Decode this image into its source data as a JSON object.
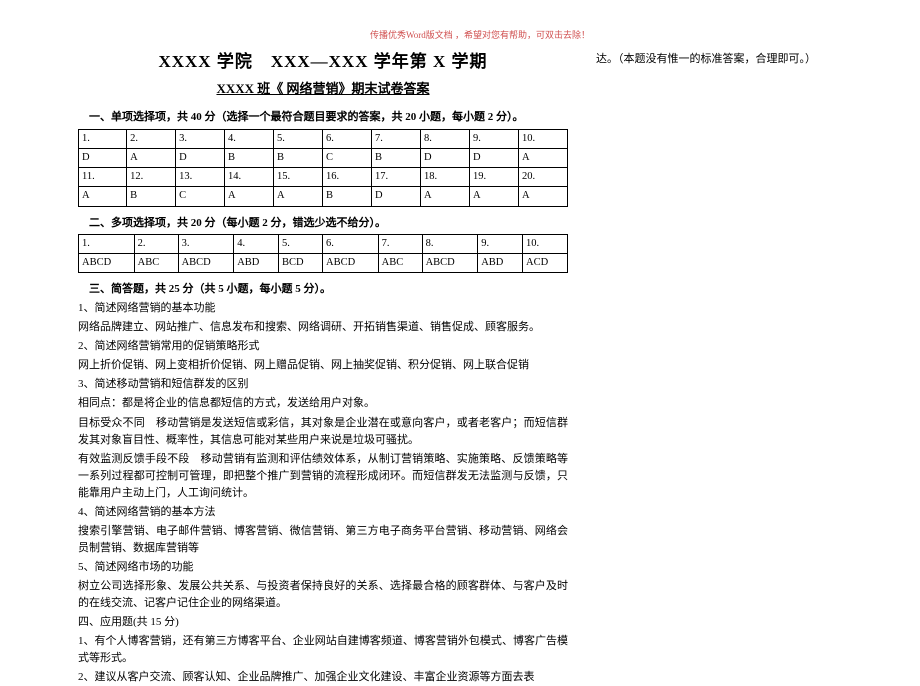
{
  "header_note": "传播优秀Word版文档 ，希望对您有帮助，可双击去除！",
  "title": "XXXX 学院　XXX—XXX 学年第 X 学期",
  "subtitle": "XXXX 班《 网络营销》期末试卷答案",
  "right_note": "达。（本题没有惟一的标准答案，合理即可。）",
  "section1_head": "一、单项选择项，共 40 分（选择一个最符合题目要求的答案，共 20 小题，每小题 2 分）。",
  "section2_head": "二、多项选择项，共 20 分（每小题 2 分，错选少选不给分）。",
  "section3_head": "三、简答题，共 25 分（共 5 小题，每小题 5 分）。",
  "section4_head": "四、应用题(共 15 分)",
  "table1": {
    "r1": [
      "1.",
      "2.",
      "3.",
      "4.",
      "5.",
      "6.",
      "7.",
      "8.",
      "9.",
      "10."
    ],
    "r2": [
      "D",
      "A",
      "D",
      "B",
      "B",
      "C",
      "B",
      "D",
      "D",
      "A"
    ],
    "r3": [
      "11.",
      "12.",
      "13.",
      "14.",
      "15.",
      "16.",
      "17.",
      "18.",
      "19.",
      "20."
    ],
    "r4": [
      "A",
      "B",
      "C",
      "A",
      "A",
      "B",
      "D",
      "A",
      "A",
      "A"
    ]
  },
  "table2": {
    "r1": [
      "1.",
      "2.",
      "3.",
      "4.",
      "5.",
      "6.",
      "7.",
      "8.",
      "9.",
      "10."
    ],
    "r2": [
      "ABCD",
      "ABC",
      "ABCD",
      "ABD",
      "BCD",
      "ABCD",
      "ABC",
      "ABCD",
      "ABD",
      "ACD"
    ]
  },
  "q1_t": "1、简述网络营销的基本功能",
  "q1_a": "网络品牌建立、网站推广、信息发布和搜索、网络调研、开拓销售渠道、销售促成、顾客服务。",
  "q2_t": "2、简述网络营销常用的促销策略形式",
  "q2_a": "网上折价促销、网上变相折价促销、网上赠品促销、网上抽奖促销、积分促销、网上联合促销",
  "q3_t": "3、简述移动营销和短信群发的区别",
  "q3_a1": "相同点：都是将企业的信息都短信的方式，发送给用户对象。",
  "q3_a2": "目标受众不同　移动营销是发送短信或彩信，其对象是企业潜在或意向客户，或者老客户；而短信群发其对象盲目性、概率性，其信息可能对某些用户来说是垃圾可骚扰。",
  "q3_a3": "有效监测反馈手段不段　移动营销有监测和评估绩效体系，从制订营销策略、实施策略、反馈策略等一系列过程都可控制可管理，即把整个推广到营销的流程形成闭环。而短信群发无法监测与反馈，只能靠用户主动上门，人工询问统计。",
  "q4_t": "4、简述网络营销的基本方法",
  "q4_a": "搜索引擎营销、电子邮件营销、博客营销、微信营销、第三方电子商务平台营销、移动营销、网络会员制营销、数据库营销等",
  "q5_t": "5、简述网络市场的功能",
  "q5_a": "树立公司选择形象、发展公共关系、与投资者保持良好的关系、选择最合格的顾客群体、与客户及时的在线交流、记客户记住企业的网络渠道。",
  "s4_1": "1、有个人博客营销，还有第三方博客平台、企业网站自建博客频道、博客营销外包模式、博客广告模式等形式。",
  "s4_2": "2、建议从客户交流、顾客认知、企业品牌推广、加强企业文化建设、丰富企业资源等方面去表"
}
